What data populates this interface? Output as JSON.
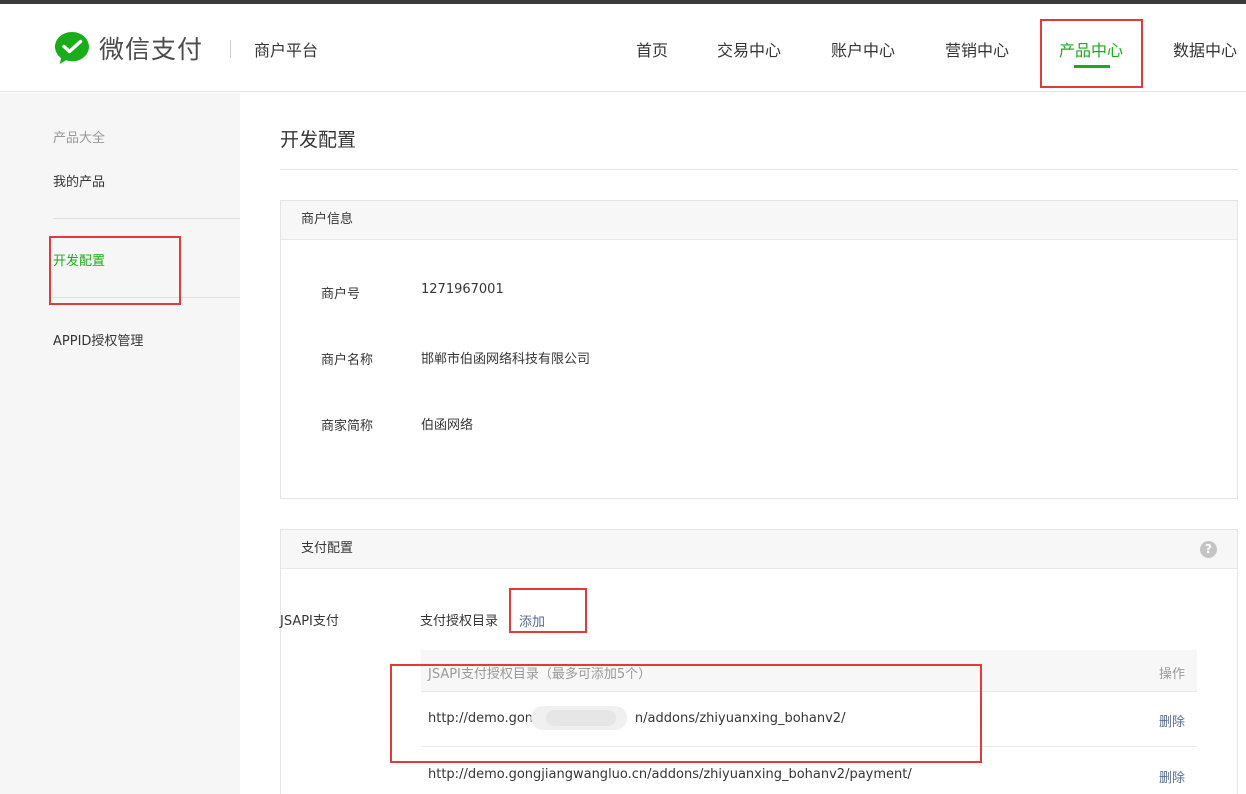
{
  "header": {
    "logo_text": "微信支付",
    "platform": "商户平台",
    "nav": [
      "首页",
      "交易中心",
      "账户中心",
      "营销中心",
      "产品中心",
      "数据中心"
    ],
    "active_nav": "产品中心"
  },
  "sidebar": {
    "group_label": "产品大全",
    "items": [
      "我的产品",
      "开发配置",
      "APPID授权管理"
    ],
    "active_item": "开发配置"
  },
  "main": {
    "title": "开发配置",
    "merchant_panel": {
      "title": "商户信息",
      "fields": [
        {
          "label": "商户号",
          "value": "1271967001"
        },
        {
          "label": "商户名称",
          "value": "邯郸市伯函网络科技有限公司"
        },
        {
          "label": "商家简称",
          "value": "伯函网络"
        }
      ]
    },
    "pay_panel": {
      "title": "支付配置",
      "help_icon_glyph": "?",
      "jsapi_label": "JSAPI支付",
      "dir_label": "支付授权目录",
      "add_label": "添加",
      "table": {
        "col_dir": "JSAPI支付授权目录（最多可添加5个）",
        "col_op": "操作",
        "rows": [
          {
            "url_prefix": "http://demo.gongj",
            "url_suffix": "n/addons/zhiyuanxing_bohanv2/",
            "action": "删除"
          },
          {
            "url": "http://demo.gongjiangwangluo.cn/addons/zhiyuanxing_bohanv2/payment/",
            "action": "删除"
          }
        ]
      }
    }
  },
  "colors": {
    "accent": "#1aad19",
    "link": "#576b95",
    "highlight_box": "#e03b3b"
  }
}
